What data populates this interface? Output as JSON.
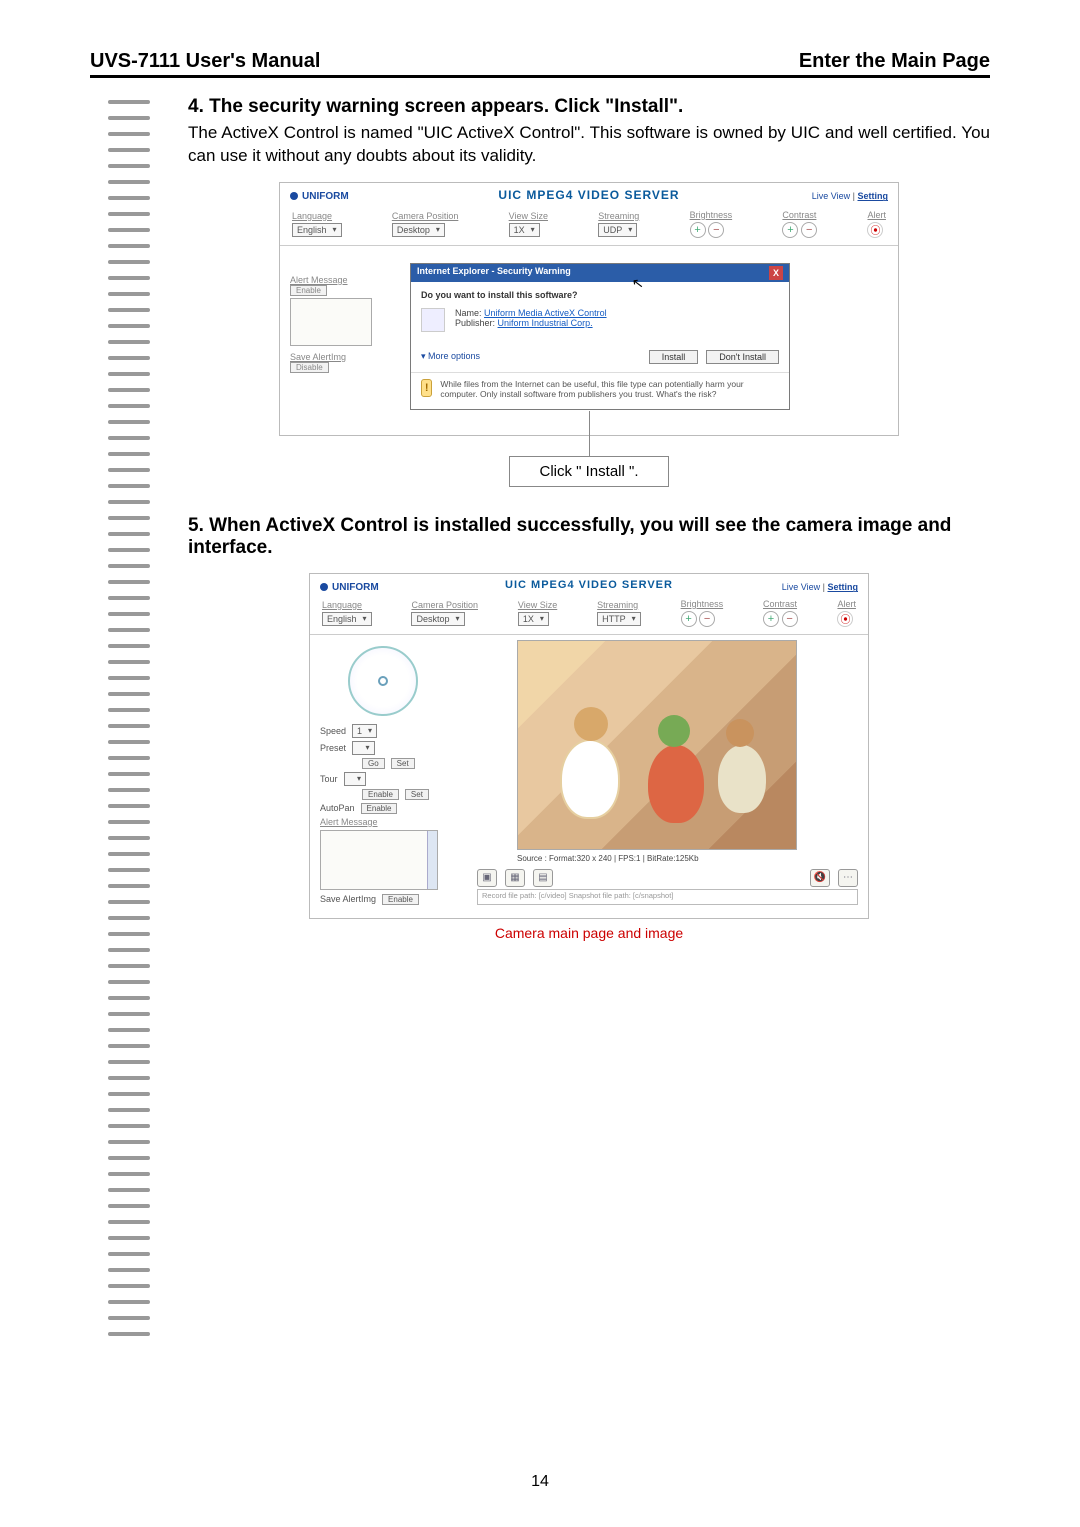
{
  "header": {
    "left": "UVS-7111 User's Manual",
    "right": "Enter the Main Page"
  },
  "step4": {
    "head": "4. The security warning screen appears. Click \"Install\".",
    "body": "The ActiveX Control is named \"UIC ActiveX Control\". This software is owned by UIC and well certified. You can use it without any doubts about its validity."
  },
  "step5": {
    "head": "5. When ActiveX Control is installed successfully, you will see the camera image and interface."
  },
  "server_title": "UIC MPEG4 VIDEO SERVER",
  "brand": "UNIFORM",
  "labels": {
    "language": "Language",
    "camera_position": "Camera Position",
    "view_size": "View Size",
    "streaming": "Streaming",
    "brightness": "Brightness",
    "contrast": "Contrast",
    "alert": "Alert",
    "alert_message": "Alert Message",
    "save_alertimg": "Save AlertImg",
    "disable": "Disable",
    "enable": "Enable",
    "speed": "Speed",
    "preset": "Preset",
    "tour": "Tour",
    "autopan": "AutoPan",
    "go": "Go",
    "set": "Set"
  },
  "selects": {
    "english": "English",
    "desktop": "Desktop",
    "1x": "1X",
    "udp": "UDP",
    "http": "HTTP",
    "one": "1"
  },
  "rlinks": {
    "live": "Live View",
    "setting": "Setting"
  },
  "ie": {
    "title": "Internet Explorer - Security Warning",
    "question": "Do you want to install this software?",
    "name_lbl": "Name:",
    "name": "Uniform Media ActiveX Control",
    "pub_lbl": "Publisher:",
    "pub": "Uniform Industrial Corp.",
    "more": "More options",
    "install": "Install",
    "dont": "Don't Install",
    "warn": "While files from the Internet can be useful, this file type can potentially harm your computer. Only install software from publishers you trust.",
    "risk": "What's the risk?"
  },
  "callout": "Click \" Install \".",
  "shot2": {
    "source": "Source : Format:320 x 240 | FPS:1 | BitRate:125Kb",
    "path": "Record file path: [c/video]  Snapshot file path: [c/snapshot]"
  },
  "caption2": "Camera main page and image",
  "page_number": "14"
}
